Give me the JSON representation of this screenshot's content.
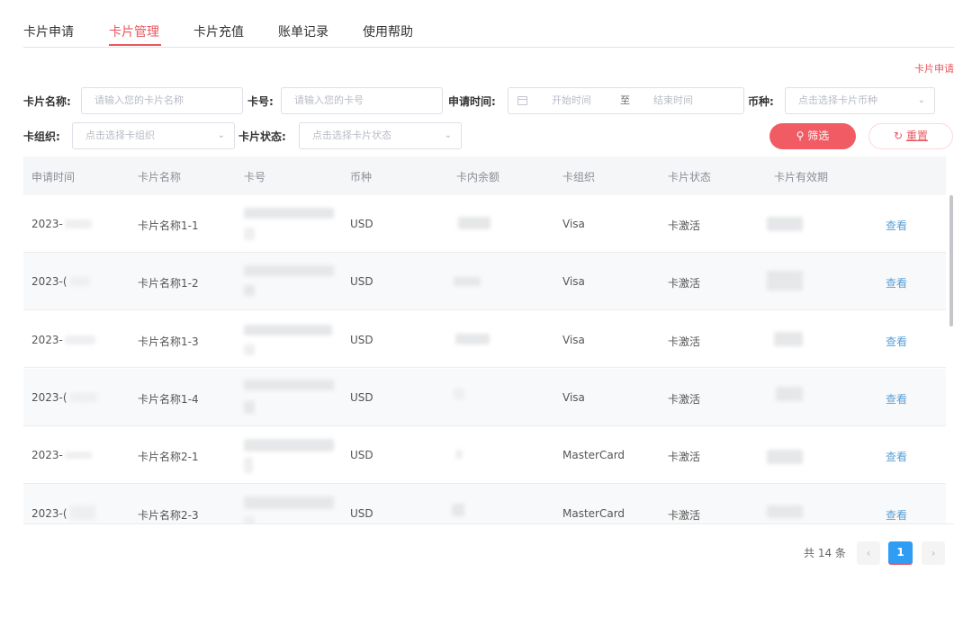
{
  "tabs": [
    {
      "label": "卡片申请"
    },
    {
      "label": "卡片管理"
    },
    {
      "label": "卡片充值"
    },
    {
      "label": "账单记录"
    },
    {
      "label": "使用帮助"
    }
  ],
  "active_tab": "卡片管理",
  "apply_link": "卡片申请",
  "filters": {
    "card_name": {
      "label": "卡片名称:",
      "placeholder": "请输入您的卡片名称"
    },
    "card_no": {
      "label": "卡号:",
      "placeholder": "请输入您的卡号"
    },
    "apply_time": {
      "label": "申请时间:",
      "start": "开始时间",
      "sep": "至",
      "end": "结束时间"
    },
    "currency": {
      "label": "币种:",
      "placeholder": "点击选择卡片币种"
    },
    "org": {
      "label": "卡组织:",
      "placeholder": "点击选择卡组织"
    },
    "status": {
      "label": "卡片状态:",
      "placeholder": "点击选择卡片状态"
    },
    "filter_button": "筛选",
    "reset_button": "重置"
  },
  "table": {
    "headers": [
      "申请时间",
      "卡片名称",
      "卡号",
      "币种",
      "卡内余额",
      "卡组织",
      "卡片状态",
      "卡片有效期"
    ],
    "rows": [
      {
        "date": "2023-",
        "name": "卡片名称1-1",
        "currency": "USD",
        "org": "Visa",
        "status": "卡激活",
        "action": "查看"
      },
      {
        "date": "2023-(",
        "name": "卡片名称1-2",
        "currency": "USD",
        "org": "Visa",
        "status": "卡激活",
        "action": "查看"
      },
      {
        "date": "2023-",
        "name": "卡片名称1-3",
        "currency": "USD",
        "org": "Visa",
        "status": "卡激活",
        "action": "查看"
      },
      {
        "date": "2023-(",
        "name": "卡片名称1-4",
        "currency": "USD",
        "org": "Visa",
        "status": "卡激活",
        "action": "查看"
      },
      {
        "date": "2023-",
        "name": "卡片名称2-1",
        "currency": "USD",
        "org": "MasterCard",
        "status": "卡激活",
        "action": "查看"
      },
      {
        "date": "2023-(",
        "name": "卡片名称2-3",
        "currency": "USD",
        "org": "MasterCard",
        "status": "卡激活",
        "action": "查看"
      }
    ]
  },
  "pagination": {
    "total": "共 14 条",
    "prev": "‹",
    "current": "1",
    "next": "›"
  },
  "icons": {
    "search": "search-icon",
    "reset": "refresh-icon",
    "calendar": "calendar-icon",
    "chevron": "chevron-down-icon"
  },
  "colors": {
    "accent": "#e8575f",
    "filter_button": "#f15b63",
    "link": "#5ba0d6",
    "page_active": "#2f9df4"
  }
}
